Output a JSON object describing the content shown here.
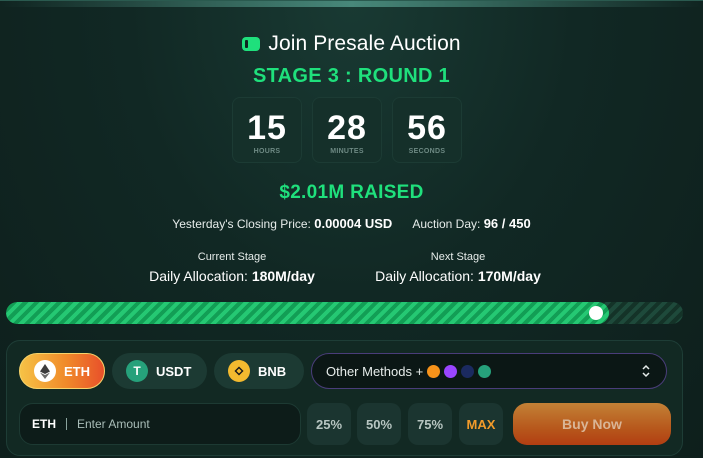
{
  "header": {
    "title": "Join Presale Auction",
    "stage": "STAGE 3 : ROUND 1"
  },
  "countdown": [
    {
      "value": "15",
      "label": "HOURS"
    },
    {
      "value": "28",
      "label": "MINUTES"
    },
    {
      "value": "56",
      "label": "SECONDS"
    }
  ],
  "raised": "$2.01M RAISED",
  "info": {
    "closing_price_label": "Yesterday's Closing Price:",
    "closing_price_value": "0.00004 USD",
    "auction_day_label": "Auction Day:",
    "auction_day_value": "96 / 450"
  },
  "stages": {
    "current": {
      "caption": "Current Stage",
      "alloc_label": "Daily Allocation:",
      "alloc_value": "180M/day"
    },
    "next": {
      "caption": "Next Stage",
      "alloc_label": "Daily Allocation:",
      "alloc_value": "170M/day"
    }
  },
  "progress": {
    "fraction": 0.89
  },
  "payment": {
    "tabs": [
      {
        "label": "ETH",
        "icon": "ethereum-icon",
        "active": true
      },
      {
        "label": "USDT",
        "icon": "tether-icon",
        "active": false
      },
      {
        "label": "BNB",
        "icon": "bnb-icon",
        "active": false
      }
    ],
    "other_methods_label": "Other Methods +"
  },
  "amount": {
    "currency": "ETH",
    "placeholder": "Enter Amount"
  },
  "presets": [
    "25%",
    "50%",
    "75%",
    "MAX"
  ],
  "buy_label": "Buy Now",
  "colors": {
    "accent_green": "#1fe07c",
    "button_orange": "#f08a2a",
    "background": "#112824"
  }
}
